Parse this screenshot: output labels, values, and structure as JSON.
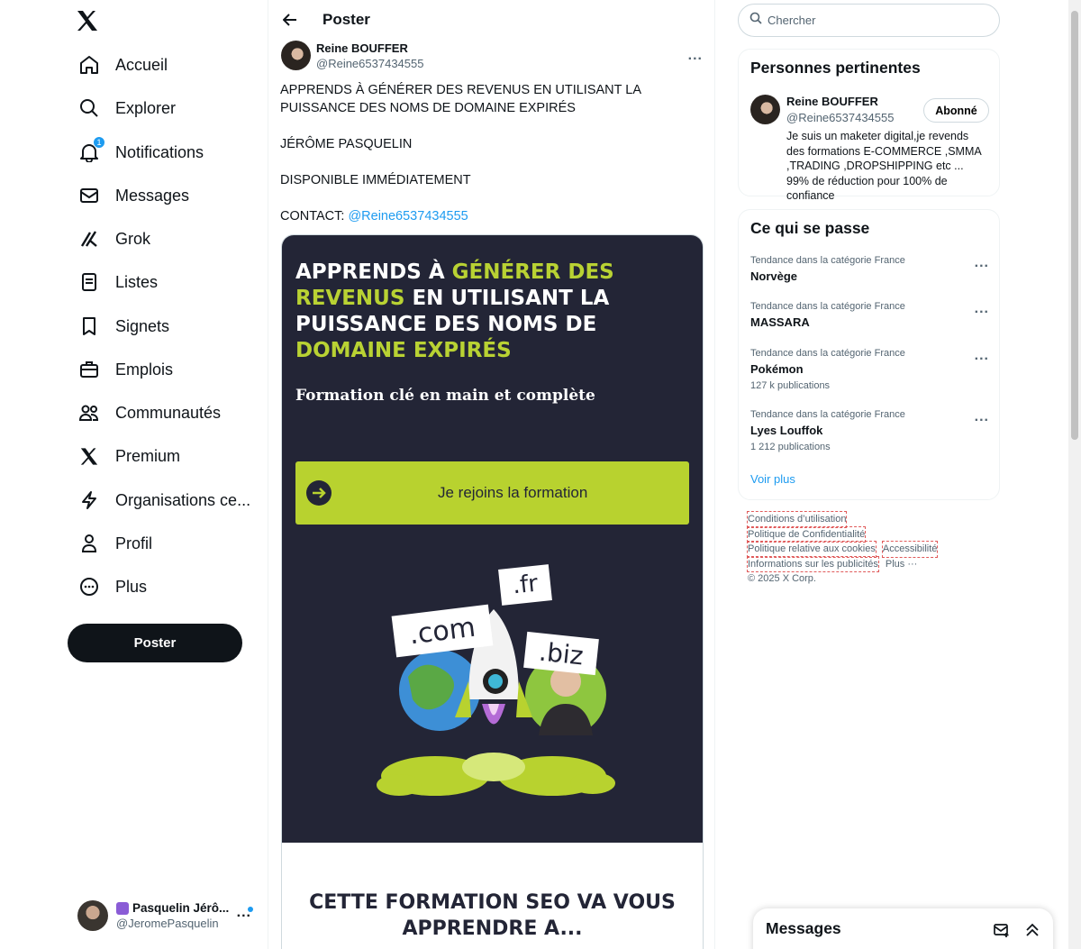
{
  "nav": {
    "logo_label": "X",
    "items": [
      {
        "label": "Accueil",
        "icon": "home-icon"
      },
      {
        "label": "Explorer",
        "icon": "search-icon"
      },
      {
        "label": "Notifications",
        "icon": "bell-icon",
        "badge": "1"
      },
      {
        "label": "Messages",
        "icon": "envelope-icon"
      },
      {
        "label": "Grok",
        "icon": "grok-icon"
      },
      {
        "label": "Listes",
        "icon": "list-icon"
      },
      {
        "label": "Signets",
        "icon": "bookmark-icon"
      },
      {
        "label": "Emplois",
        "icon": "briefcase-icon"
      },
      {
        "label": "Communautés",
        "icon": "people-icon"
      },
      {
        "label": "Premium",
        "icon": "x-logo-icon"
      },
      {
        "label": "Organisations ce...",
        "icon": "lightning-icon"
      },
      {
        "label": "Profil",
        "icon": "person-icon"
      },
      {
        "label": "Plus",
        "icon": "more-circle-icon"
      }
    ],
    "post_button": "Poster"
  },
  "account": {
    "display_name": "Pasquelin Jérô...",
    "handle": "@JeromePasquelin",
    "more": "..."
  },
  "main": {
    "title": "Poster",
    "author": {
      "name": "Reine BOUFFER",
      "handle": "@Reine6537434555",
      "more": "..."
    },
    "text": {
      "line1": "APPRENDS À GÉNÉRER DES REVENUS EN UTILISANT LA PUISSANCE DES NOMS DE DOMAINE EXPIRÉS",
      "line2": "JÉRÔME PASQUELIN",
      "line3": "DISPONIBLE IMMÉDIATEMENT",
      "contact_prefix": "CONTACT: ",
      "contact_link": "@Reine6537434555"
    },
    "media": {
      "headline_part1": "APPRENDS À ",
      "headline_hl1": "GÉNÉRER DES REVENUS",
      "headline_part2": " EN UTILISANT LA PUISSANCE DES NOMS DE ",
      "headline_hl2": "DOMAINE EXPIRÉS",
      "subtitle": "Formation clé en main et complète",
      "cta": "Je rejoins la formation",
      "tag_com": ".com",
      "tag_fr": ".fr",
      "tag_biz": ".biz",
      "bottom_line1": "CETTE FORMATION SEO VA VOUS",
      "bottom_line2": "APPRENDRE A..."
    }
  },
  "right": {
    "search_placeholder": "Chercher",
    "relevant": {
      "title": "Personnes pertinentes",
      "name": "Reine BOUFFER",
      "handle": "@Reine6537434555",
      "follow_label": "Abonné",
      "bio": "Je suis un maketer digital,je revends des formations E-COMMERCE ,SMMA ,TRADING ,DROPSHIPPING etc ... 99% de réduction pour 100% de confiance"
    },
    "trends": {
      "title": "Ce qui se passe",
      "items": [
        {
          "context": "Tendance dans la catégorie France",
          "topic": "Norvège",
          "count": ""
        },
        {
          "context": "Tendance dans la catégorie France",
          "topic": "MASSARA",
          "count": ""
        },
        {
          "context": "Tendance dans la catégorie France",
          "topic": "Pokémon",
          "count": "127 k publications"
        },
        {
          "context": "Tendance dans la catégorie France",
          "topic": "Lyes Louffok",
          "count": "1 212 publications"
        }
      ],
      "more_dots": "...",
      "see_more": "Voir plus"
    },
    "footer": {
      "terms": "Conditions d’utilisation",
      "privacy": "Politique de Confidentialité",
      "cookies": "Politique relative aux cookies",
      "accessibility": "Accessibilité",
      "ads": "Informations sur les publicités",
      "more": "Plus ···",
      "copyright": "© 2025 X Corp."
    }
  },
  "drawer": {
    "title": "Messages"
  },
  "colors": {
    "accent": "#1d9bf0",
    "media_bg": "#232536",
    "media_green": "#b8d22f"
  }
}
